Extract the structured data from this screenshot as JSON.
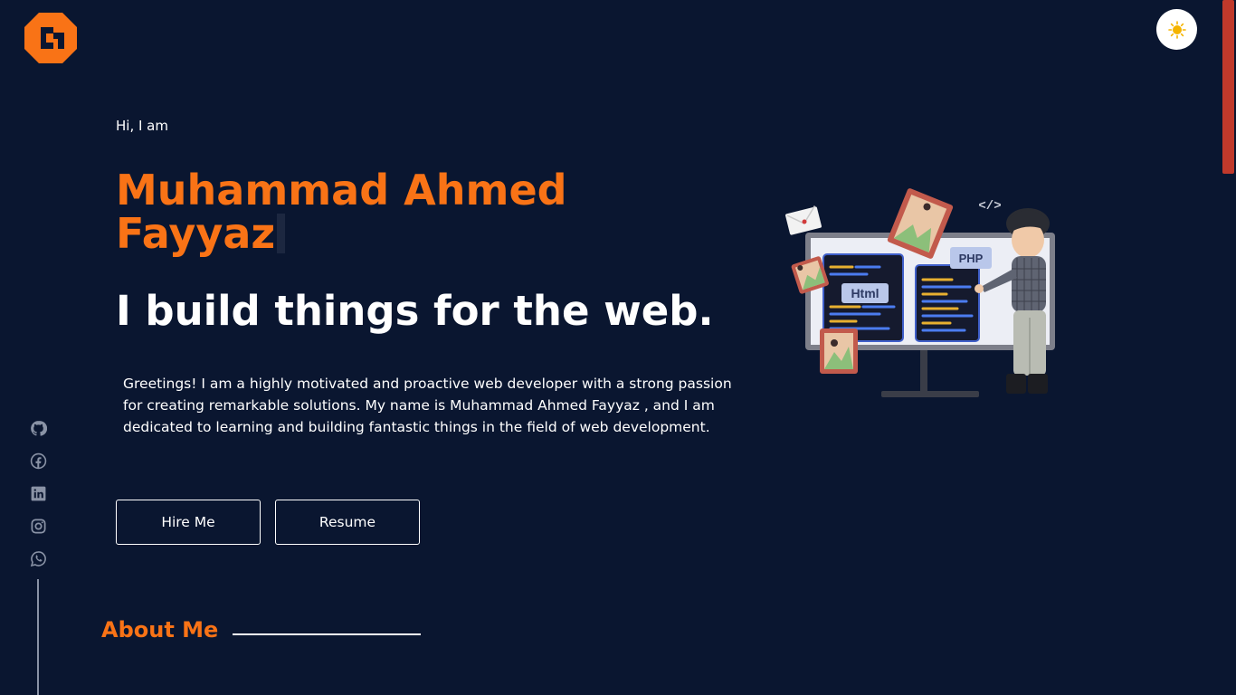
{
  "header": {
    "logo_icon": "brand-logo-icon",
    "theme_toggle_icon": "sun-icon"
  },
  "hero": {
    "greeting": "Hi, I am",
    "name": "Muhammad Ahmed Fayyaz",
    "tagline": "I build things for the web.",
    "intro": "Greetings! I am a highly motivated and proactive web developer with a strong passion for creating remarkable solutions. My name is Muhammad Ahmed Fayyaz , and I am dedicated to learning and building fantastic things in the field of web development.",
    "buttons": {
      "hire": "Hire Me",
      "resume": "Resume"
    },
    "illustration": {
      "labels": {
        "html": "Html",
        "php": "PHP",
        "code_tag": "</>"
      }
    }
  },
  "socials": [
    {
      "icon": "github-icon"
    },
    {
      "icon": "facebook-icon"
    },
    {
      "icon": "linkedin-icon"
    },
    {
      "icon": "instagram-icon"
    },
    {
      "icon": "whatsapp-icon"
    }
  ],
  "sections": {
    "about_title": "About Me"
  },
  "colors": {
    "background": "#0a1630",
    "accent": "#f97316",
    "text": "#ffffff",
    "scrollbar": "#c0392b"
  }
}
